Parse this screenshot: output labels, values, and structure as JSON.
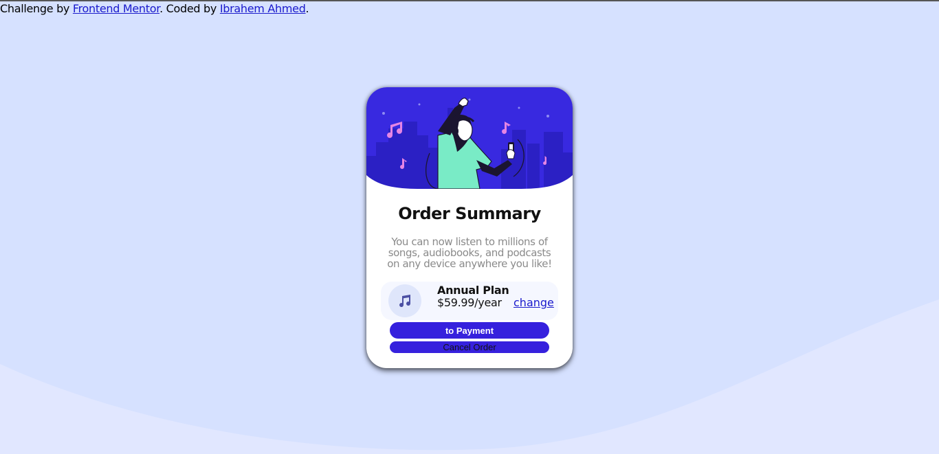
{
  "attribution": {
    "prefix": "Challenge by ",
    "mentor_link": "Frontend Mentor",
    "middle": ". Coded by ",
    "author_link": "Ibrahem Ahmed",
    "suffix": "."
  },
  "card": {
    "title": "Order Summary",
    "description": "You can now listen to millions of songs, audiobooks, and podcasts on any device anywhere you like!",
    "plan": {
      "icon": "music-note-icon",
      "name": "Annual Plan",
      "price": "$59.99/year",
      "change_label": "change"
    },
    "payment_button": "to Payment",
    "cancel_button": "Cancel Order"
  },
  "colors": {
    "background": "#d6e1ff",
    "wave": "#e1e7ff",
    "card": "#ffffff",
    "hero": "#3829e0",
    "primary_button": "#3621dd",
    "link": "#1a1acc",
    "muted_text": "#8a8a8a"
  }
}
